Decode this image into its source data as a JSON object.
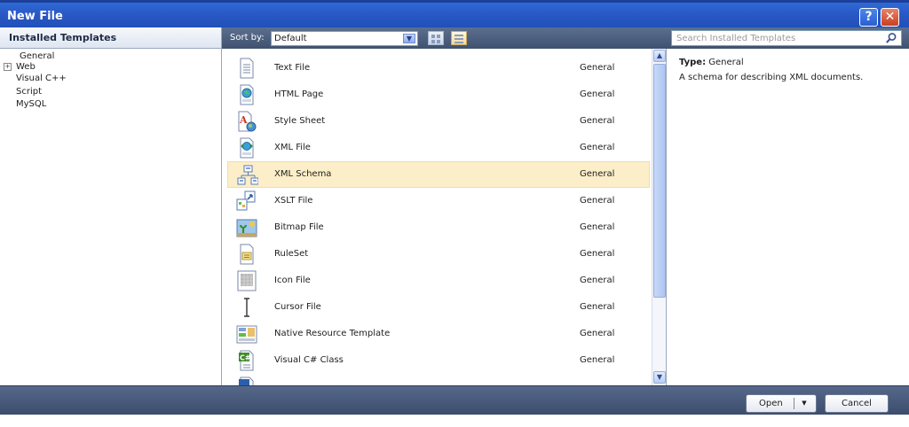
{
  "window": {
    "title": "New File"
  },
  "title_buttons": {
    "help": "?",
    "close": "✕"
  },
  "sidebar": {
    "title": "Installed Templates",
    "items": [
      {
        "label": "General",
        "expandable": false
      },
      {
        "label": "Web",
        "expandable": true
      },
      {
        "label": "Visual C++",
        "expandable": false
      },
      {
        "label": "Script",
        "expandable": false
      },
      {
        "label": "MySQL",
        "expandable": false
      }
    ]
  },
  "toolbar": {
    "sort_label": "Sort by:",
    "sort_value": "Default",
    "search_placeholder": "Search Installed Templates"
  },
  "templates": [
    {
      "name": "Text File",
      "category": "General",
      "icon": "text-file-icon"
    },
    {
      "name": "HTML Page",
      "category": "General",
      "icon": "html-page-icon"
    },
    {
      "name": "Style Sheet",
      "category": "General",
      "icon": "style-sheet-icon"
    },
    {
      "name": "XML File",
      "category": "General",
      "icon": "xml-file-icon"
    },
    {
      "name": "XML Schema",
      "category": "General",
      "icon": "xml-schema-icon",
      "selected": true
    },
    {
      "name": "XSLT File",
      "category": "General",
      "icon": "xslt-file-icon"
    },
    {
      "name": "Bitmap File",
      "category": "General",
      "icon": "bitmap-file-icon"
    },
    {
      "name": "RuleSet",
      "category": "General",
      "icon": "ruleset-icon"
    },
    {
      "name": "Icon File",
      "category": "General",
      "icon": "icon-file-icon"
    },
    {
      "name": "Cursor File",
      "category": "General",
      "icon": "cursor-file-icon"
    },
    {
      "name": "Native Resource Template",
      "category": "General",
      "icon": "native-resource-icon"
    },
    {
      "name": "Visual C# Class",
      "category": "General",
      "icon": "csharp-class-icon"
    }
  ],
  "details": {
    "type_label": "Type:",
    "type_value": "General",
    "description": "A schema for describing XML documents."
  },
  "footer": {
    "open_label": "Open",
    "cancel_label": "Cancel"
  },
  "colors": {
    "titlebar": "#2a58c6",
    "header_strip": "#4a5c7c",
    "selection": "#fbeec8"
  }
}
